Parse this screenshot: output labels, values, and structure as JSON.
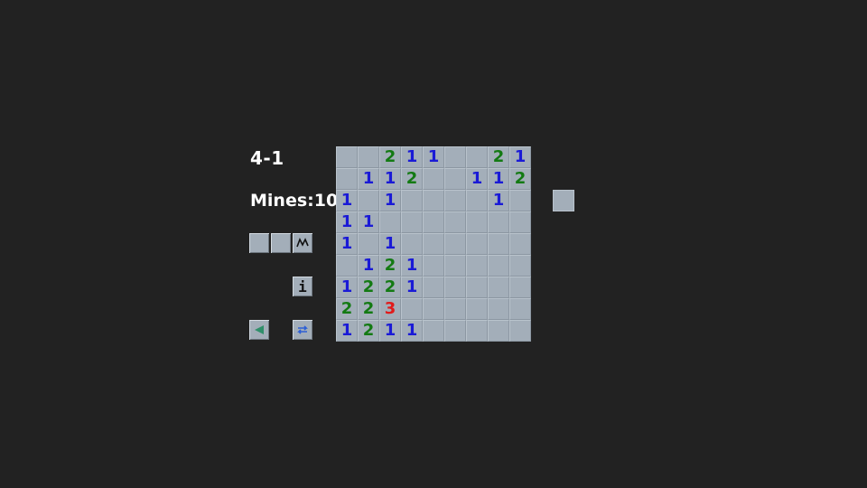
{
  "level": "4-1",
  "mines_label": "Mines:10",
  "colors": {
    "background": "#222222",
    "cell": "#a3aeb9",
    "n1": "#1a1ad6",
    "n2": "#137a13",
    "n3": "#e01b1b"
  },
  "icons": {
    "hint": "squiggle-icon",
    "info": "info-icon",
    "back": "back-arrow-icon",
    "restart": "swap-arrows-icon"
  },
  "info_glyph": "i",
  "board": [
    [
      "",
      "",
      "2",
      "1",
      "1",
      "",
      "",
      "2",
      "1"
    ],
    [
      "",
      "1",
      "1",
      "2",
      "",
      "",
      "1",
      "1",
      "2"
    ],
    [
      "1",
      "",
      "1",
      "",
      "",
      "",
      "",
      "1",
      ""
    ],
    [
      "1",
      "1",
      "",
      "",
      "",
      "",
      "",
      "",
      ""
    ],
    [
      "1",
      "",
      "1",
      "",
      "",
      "",
      "",
      "",
      ""
    ],
    [
      "",
      "1",
      "2",
      "1",
      "",
      "",
      "",
      "",
      ""
    ],
    [
      "1",
      "2",
      "2",
      "1",
      "",
      "",
      "",
      "",
      ""
    ],
    [
      "2",
      "2",
      "3",
      "",
      "",
      "",
      "",
      "",
      ""
    ],
    [
      "1",
      "2",
      "1",
      "1",
      "",
      "",
      "",
      "",
      ""
    ]
  ]
}
